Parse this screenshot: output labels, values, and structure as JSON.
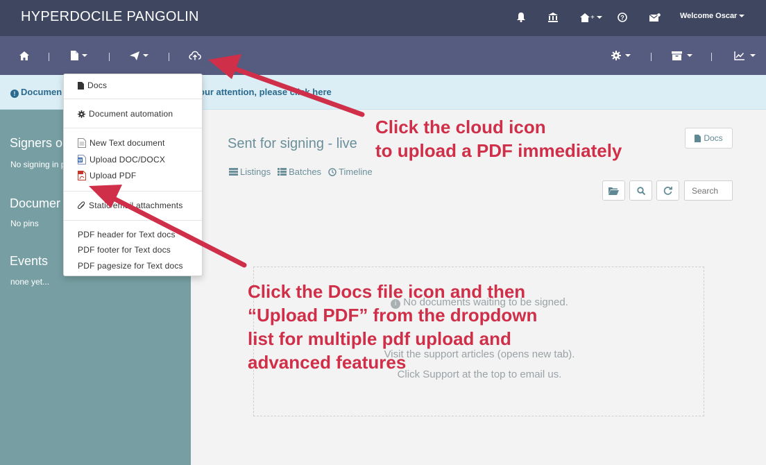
{
  "app": {
    "brand": "HYPERDOCILE PANGOLIN"
  },
  "topbar": {
    "welcome": "Welcome Oscar"
  },
  "alert": {
    "left_text": "Documen",
    "right_text": "our attention, please click here"
  },
  "sidebar": {
    "signers_heading": "Signers o",
    "signers_sub": "No signing in p",
    "documents_heading": "Documer",
    "documents_sub": "No pins",
    "events_heading": "Events",
    "events_sub": "none yet..."
  },
  "main": {
    "title": "Sent for signing - live",
    "docs_button": "Docs",
    "views": {
      "listings": "Listings",
      "batches": "Batches",
      "timeline": "Timeline"
    },
    "search_placeholder": "Search",
    "empty": {
      "line1": "No documents waiting to be signed.",
      "line2": "Visit the support articles (opens new tab).",
      "line3": "Click Support at the top to email us."
    }
  },
  "dropdown": {
    "docs": "Docs",
    "document_automation": "Document automation",
    "new_text_document": "New Text document",
    "upload_doc_docx": "Upload DOC/DOCX",
    "upload_pdf": "Upload PDF",
    "static_email_attachments": "Static email attachments",
    "pdf_header": "PDF header for Text docs",
    "pdf_footer": "PDF footer for Text docs",
    "pdf_pagesize": "PDF pagesize for Text docs"
  },
  "annotations": {
    "cloud_line1": "Click the cloud icon",
    "cloud_line2": "to upload a PDF immediately",
    "docs_line1": "Click the Docs file icon and then",
    "docs_line2": "“Upload PDF” from the dropdown",
    "docs_line3": "list for multiple pdf upload and",
    "docs_line4": "advanced features"
  },
  "colors": {
    "topbar": "#3f4660",
    "navbar": "#565b80",
    "sidebar": "#779fa3",
    "alert": "#dbeef5",
    "annotation": "#cf2f48"
  }
}
